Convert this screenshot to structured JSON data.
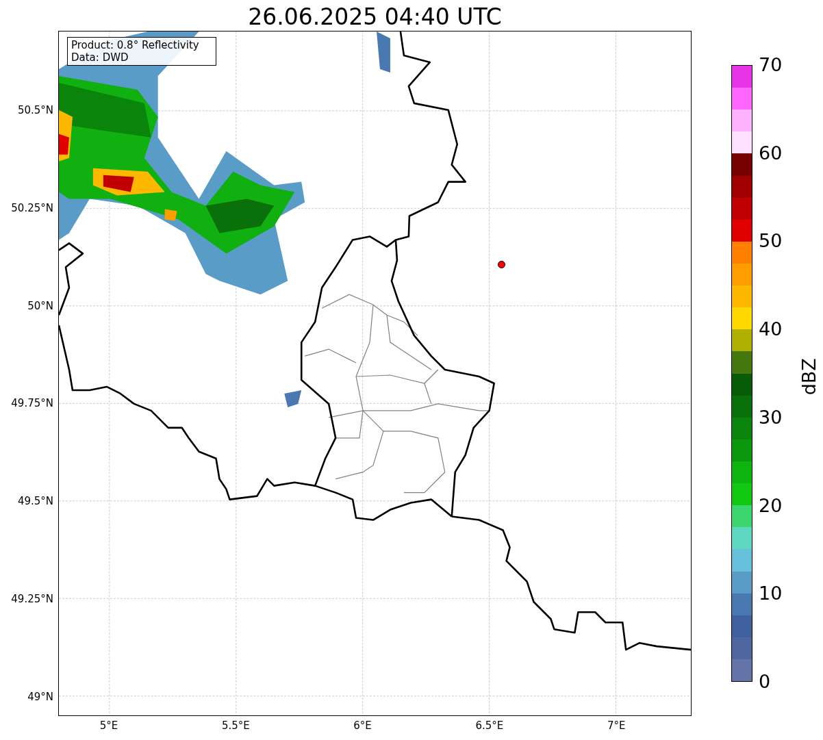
{
  "title": "26.06.2025 04:40 UTC",
  "legend": [
    "Product: 0.8° Reflectivity",
    "Data: DWD"
  ],
  "axes": {
    "x_ticks": [
      "5°E",
      "5.5°E",
      "6°E",
      "6.5°E",
      "7°E"
    ],
    "y_ticks": [
      "50.5°N",
      "50.25°N",
      "50°N",
      "49.75°N",
      "49.5°N",
      "49.25°N",
      "49°N"
    ]
  },
  "colorbar": {
    "ticks": [
      "70",
      "60",
      "50",
      "40",
      "30",
      "20",
      "10",
      "0"
    ],
    "label": "dBZ",
    "bins": [
      {
        "color": "#e833e8"
      },
      {
        "color": "#ff66ff"
      },
      {
        "color": "#ffb3ff"
      },
      {
        "color": "#ffe0ff"
      },
      {
        "color": "#780000"
      },
      {
        "color": "#a00000"
      },
      {
        "color": "#c00000"
      },
      {
        "color": "#e00000"
      },
      {
        "color": "#ff8000"
      },
      {
        "color": "#ff9c00"
      },
      {
        "color": "#ffb800"
      },
      {
        "color": "#ffd800"
      },
      {
        "color": "#b0b000"
      },
      {
        "color": "#467810"
      },
      {
        "color": "#085c08"
      },
      {
        "color": "#0a700a"
      },
      {
        "color": "#0a840a"
      },
      {
        "color": "#0c980c"
      },
      {
        "color": "#0eb40e"
      },
      {
        "color": "#10c810"
      },
      {
        "color": "#3cd66e"
      },
      {
        "color": "#5ed8c0"
      },
      {
        "color": "#66c0dc"
      },
      {
        "color": "#5a9cc8"
      },
      {
        "color": "#4a78b0"
      },
      {
        "color": "#4060a0"
      },
      {
        "color": "#5066a0"
      },
      {
        "color": "#6474a8"
      }
    ]
  }
}
